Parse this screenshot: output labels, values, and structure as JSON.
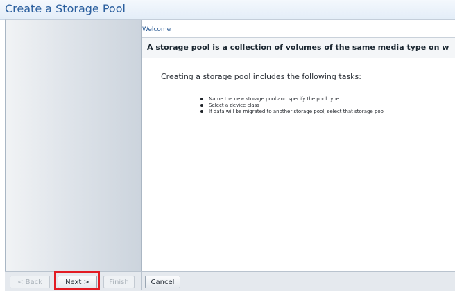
{
  "window": {
    "title": "Create a Storage Pool"
  },
  "wizard": {
    "breadcrumb": "Welcome",
    "heading": "A storage pool is a collection of volumes of the same media type on w",
    "intro": "Creating a storage pool includes the following tasks:",
    "tasks": [
      "Name the new storage pool and specify the pool type",
      "Select a device class",
      "If data will be migrated to another storage pool, select that storage poo"
    ]
  },
  "buttons": {
    "back": "< Back",
    "next": "Next >",
    "finish": "Finish",
    "cancel": "Cancel"
  },
  "colors": {
    "title": "#2b5f9e",
    "highlight": "#e21b23"
  }
}
